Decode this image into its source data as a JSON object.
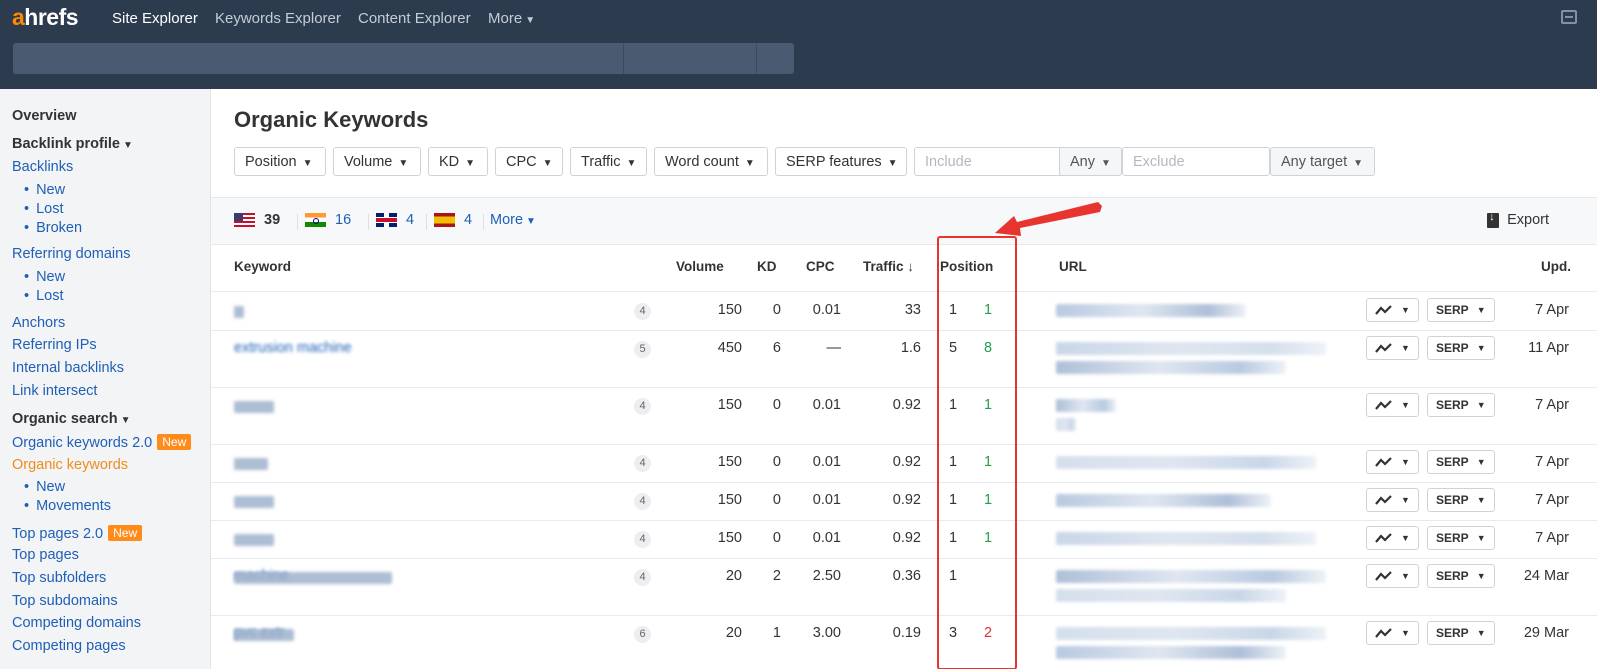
{
  "header": {
    "logo_prefix": "a",
    "logo_rest": "hrefs",
    "nav": [
      "Site Explorer",
      "Keywords Explorer",
      "Content Explorer",
      "More"
    ]
  },
  "sidebar": {
    "overview": "Overview",
    "backlink_profile": "Backlink profile",
    "backlinks": "Backlinks",
    "backlinks_sub": [
      "New",
      "Lost",
      "Broken"
    ],
    "referring_domains": "Referring domains",
    "referring_domains_sub": [
      "New",
      "Lost"
    ],
    "anchors": "Anchors",
    "referring_ips": "Referring IPs",
    "internal_backlinks": "Internal backlinks",
    "link_intersect": "Link intersect",
    "organic_search": "Organic search",
    "organic_keywords_2": "Organic keywords 2.0",
    "organic_keywords": "Organic keywords",
    "organic_keywords_sub": [
      "New",
      "Movements"
    ],
    "top_pages_2": "Top pages 2.0",
    "top_pages": "Top pages",
    "top_subfolders": "Top subfolders",
    "top_subdomains": "Top subdomains",
    "competing_domains": "Competing domains",
    "competing_pages": "Competing pages",
    "new_badge": "New"
  },
  "main": {
    "title": "Organic Keywords",
    "filters": [
      "Position",
      "Volume",
      "KD",
      "CPC",
      "Traffic",
      "Word count",
      "SERP features"
    ],
    "include_placeholder": "Include",
    "any_label": "Any",
    "exclude_placeholder": "Exclude",
    "any_target": "Any target",
    "countries": [
      {
        "flag": "us",
        "count": "39"
      },
      {
        "flag": "in",
        "count": "16"
      },
      {
        "flag": "gb",
        "count": "4"
      },
      {
        "flag": "es",
        "count": "4"
      }
    ],
    "more": "More",
    "export": "Export",
    "columns": {
      "keyword": "Keyword",
      "volume": "Volume",
      "kd": "KD",
      "cpc": "CPC",
      "traffic": "Traffic ↓",
      "position": "Position",
      "url": "URL",
      "upd": "Upd."
    },
    "serp_label": "SERP",
    "rows": [
      {
        "keyword": "",
        "words": "4",
        "volume": "150",
        "kd": "0",
        "cpc": "0.01",
        "traffic": "33",
        "pos": "1",
        "change": "1",
        "change_dir": "up",
        "upd": "7 Apr"
      },
      {
        "keyword": "extrusion machine",
        "words": "5",
        "volume": "450",
        "kd": "6",
        "cpc": "—",
        "traffic": "1.6",
        "pos": "5",
        "change": "8",
        "change_dir": "up",
        "upd": "11 Apr"
      },
      {
        "keyword": "",
        "words": "4",
        "volume": "150",
        "kd": "0",
        "cpc": "0.01",
        "traffic": "0.92",
        "pos": "1",
        "change": "1",
        "change_dir": "up",
        "upd": "7 Apr"
      },
      {
        "keyword": "",
        "words": "4",
        "volume": "150",
        "kd": "0",
        "cpc": "0.01",
        "traffic": "0.92",
        "pos": "1",
        "change": "1",
        "change_dir": "up",
        "upd": "7 Apr"
      },
      {
        "keyword": "",
        "words": "4",
        "volume": "150",
        "kd": "0",
        "cpc": "0.01",
        "traffic": "0.92",
        "pos": "1",
        "change": "1",
        "change_dir": "up",
        "upd": "7 Apr"
      },
      {
        "keyword": "",
        "words": "4",
        "volume": "150",
        "kd": "0",
        "cpc": "0.01",
        "traffic": "0.92",
        "pos": "1",
        "change": "1",
        "change_dir": "up",
        "upd": "7 Apr"
      },
      {
        "keyword": "machine",
        "words": "4",
        "volume": "20",
        "kd": "2",
        "cpc": "2.50",
        "traffic": "0.36",
        "pos": "1",
        "change": "",
        "change_dir": "none",
        "upd": "24 Mar"
      },
      {
        "keyword": "pvc extr",
        "words": "6",
        "volume": "20",
        "kd": "1",
        "cpc": "3.00",
        "traffic": "0.19",
        "pos": "3",
        "change": "2",
        "change_dir": "down",
        "upd": "29 Mar"
      }
    ]
  },
  "colors": {
    "header_bg": "#2d3b4f",
    "link": "#1f5fb6",
    "accent": "#ff8800",
    "highlight": "#e8342f",
    "up": "#24a148",
    "down": "#e0322f"
  }
}
